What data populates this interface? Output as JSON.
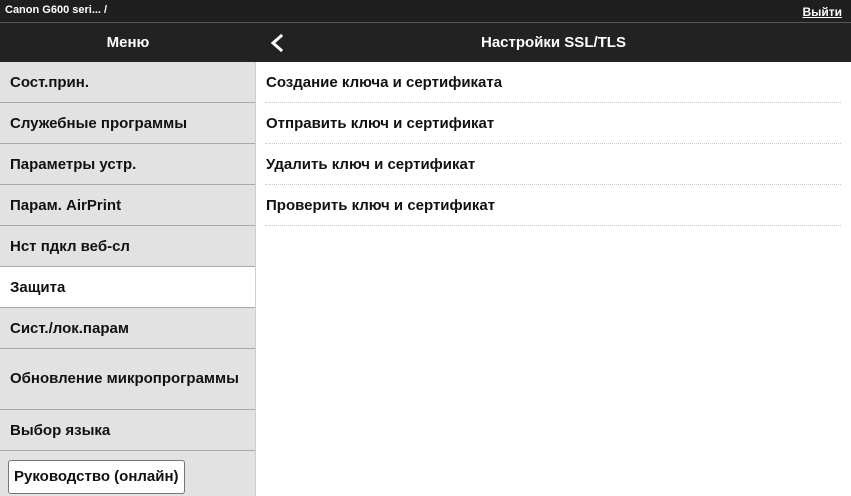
{
  "topbar": {
    "device_name": "Canon G600 seri... /",
    "logout_label": "Выйти"
  },
  "header": {
    "menu_title": "Меню",
    "page_title": "Настройки SSL/TLS",
    "back_icon": "chevron-left-icon"
  },
  "sidebar": {
    "items": [
      {
        "label": "Сост.прин."
      },
      {
        "label": "Служебные программы"
      },
      {
        "label": "Параметры устр."
      },
      {
        "label": "Парам. AirPrint"
      },
      {
        "label": "Нст пдкл веб-сл"
      },
      {
        "label": "Защита",
        "active": true
      },
      {
        "label": "Сист./лок.парам"
      },
      {
        "label": "Обновление микропрограммы"
      },
      {
        "label": "Выбор языка"
      }
    ],
    "manual_label": "Руководство (онлайн)"
  },
  "main": {
    "items": [
      {
        "label": "Создание ключа и сертификата"
      },
      {
        "label": "Отправить ключ и сертификат"
      },
      {
        "label": "Удалить ключ и сертификат"
      },
      {
        "label": "Проверить ключ и сертификат"
      }
    ]
  },
  "colors": {
    "topbar_bg": "#1f1f1f",
    "header_bg": "#222222",
    "sidebar_bg": "#e2e2e2",
    "active_bg": "#ffffff"
  }
}
